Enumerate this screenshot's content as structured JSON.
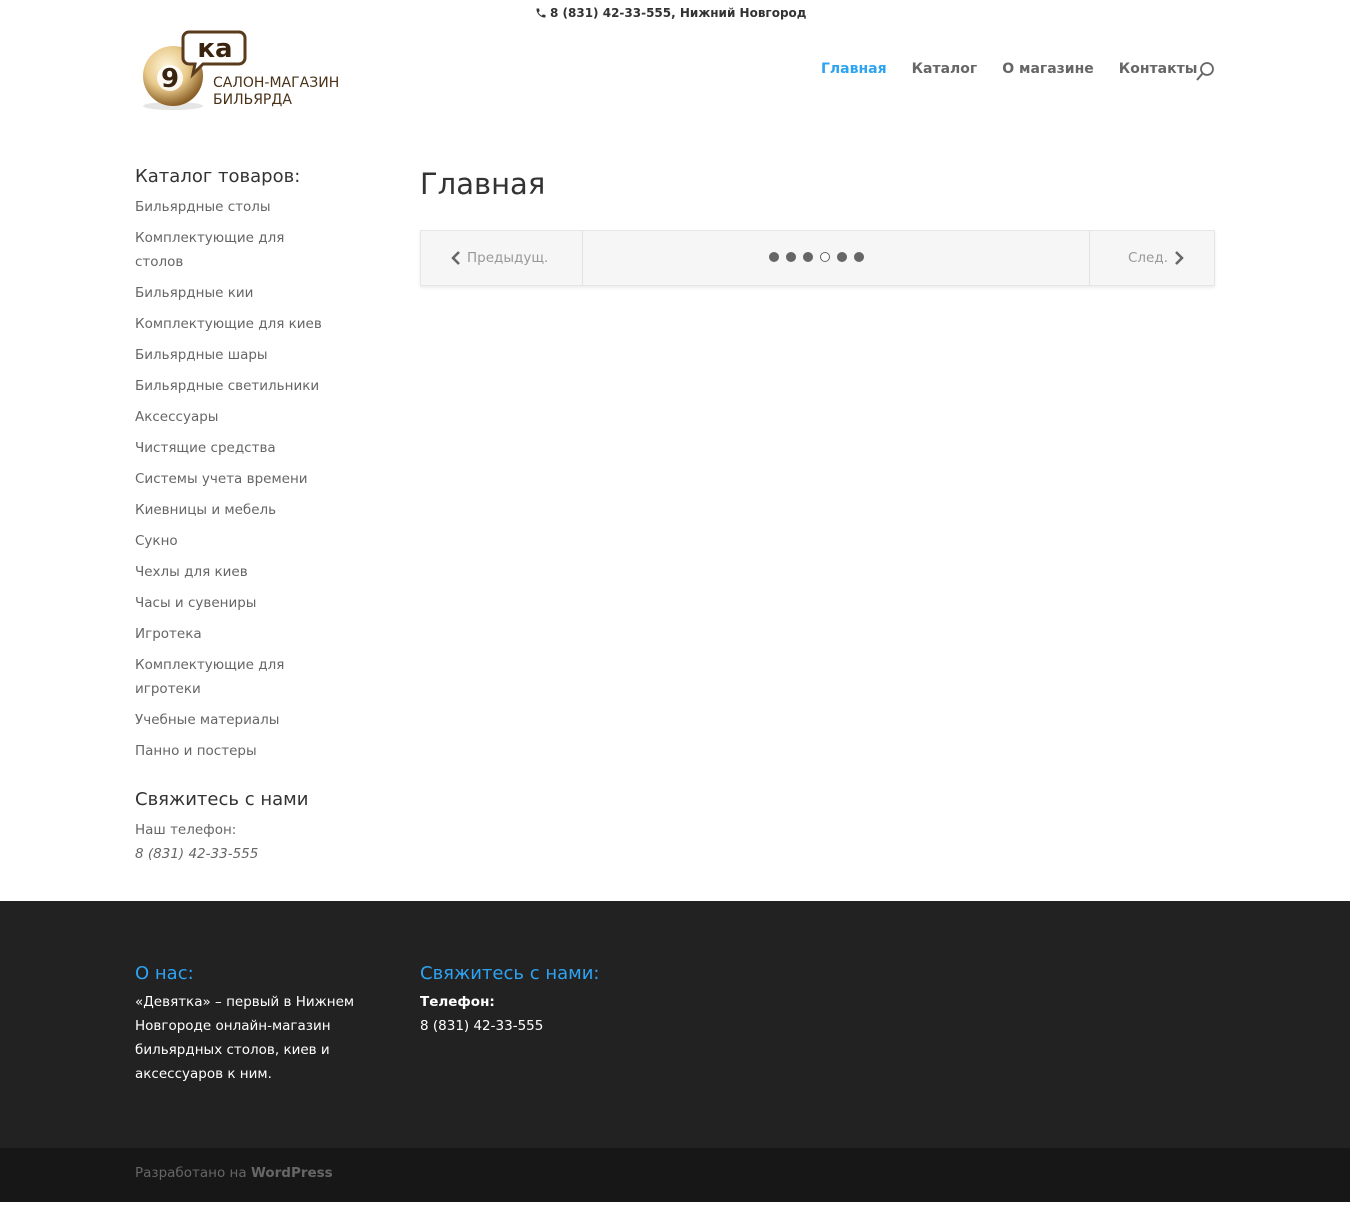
{
  "top_bar": {
    "contact": "8 (831) 42-33-555, Нижний Новгород"
  },
  "logo": {
    "badge_text": "ка",
    "ball_number": "9",
    "line1": "САЛОН-МАГАЗИН",
    "line2": "БИЛЬЯРДА",
    "colors": {
      "brown": "#5a3b1e",
      "ball": "#e8c98a"
    }
  },
  "nav": {
    "items": [
      {
        "label": "Главная",
        "active": true
      },
      {
        "label": "Каталог",
        "active": false
      },
      {
        "label": "О магазине",
        "active": false
      },
      {
        "label": "Контакты",
        "active": false
      }
    ],
    "accent_color": "#2ea3f2"
  },
  "sidebar": {
    "catalog_title": "Каталог товаров:",
    "categories": [
      "Бильярдные столы",
      "Комплектующие для столов",
      "Бильярдные кии",
      "Комплектующие для киев",
      "Бильярдные шары",
      "Бильярдные светильники",
      "Аксессуары",
      "Чистящие средства",
      "Системы учета времени",
      "Киевницы и мебель",
      "Сукно",
      "Чехлы для киев",
      "Часы и сувениры",
      "Игротека",
      "Комплектующие для игротеки",
      "Учебные материалы",
      "Панно и постеры"
    ],
    "contact_title": "Свяжитесь с нами",
    "phone_label": "Наш телефон:",
    "phone": "8 (831) 42-33-555"
  },
  "main": {
    "title": "Главная",
    "slider": {
      "prev_label": "Предыдущ.",
      "next_label": "След.",
      "dots_count": 6,
      "current_dot": 4
    }
  },
  "footer": {
    "about_title": "О нас:",
    "about_text": "«Девятка» – первый в Нижнем Новгороде онлайн-магазин бильярдных столов, киев и аксессуаров к ним.",
    "contact_title": "Свяжитесь с нами:",
    "phone_label": "Телефон:",
    "phone": "8 (831) 42-33-555",
    "credits_prefix": "Разработано на",
    "credits_link": "WordPress"
  }
}
